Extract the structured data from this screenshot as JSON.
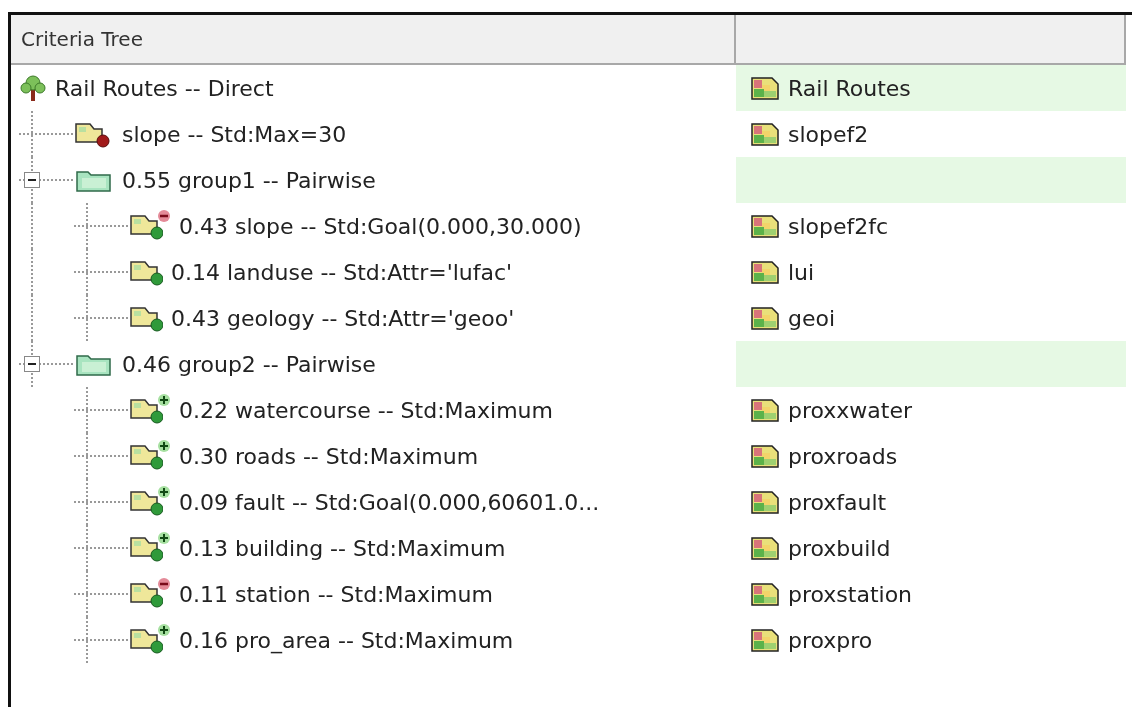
{
  "header": {
    "column_1": "Criteria Tree"
  },
  "tree": {
    "kind": "root",
    "label": "Rail Routes -- Direct",
    "layer": "Rail Routes",
    "children": [
      {
        "kind": "constraint",
        "label": "slope -- Std:Max=30",
        "layer": "slopef2"
      },
      {
        "kind": "group",
        "label": "0.55 group1 -- Pairwise",
        "expanded": true,
        "children": [
          {
            "kind": "minusfactor",
            "label": "0.43 slope -- Std:Goal(0.000,30.000)",
            "layer": "slopef2fc"
          },
          {
            "kind": "factor",
            "label": "0.14 landuse -- Std:Attr='lufac'",
            "layer": "lui"
          },
          {
            "kind": "factor",
            "label": "0.43 geology -- Std:Attr='geoo'",
            "layer": "geoi"
          }
        ]
      },
      {
        "kind": "group",
        "label": "0.46 group2 -- Pairwise",
        "expanded": true,
        "children": [
          {
            "kind": "plusfactor",
            "label": "0.22 watercourse -- Std:Maximum",
            "layer": "proxxwater"
          },
          {
            "kind": "plusfactor",
            "label": "0.30 roads -- Std:Maximum",
            "layer": "proxroads"
          },
          {
            "kind": "plusfactor",
            "label": "0.09 fault -- Std:Goal(0.000,60601.0...",
            "layer": "proxfault"
          },
          {
            "kind": "plusfactor",
            "label": "0.13 building -- Std:Maximum",
            "layer": "proxbuild"
          },
          {
            "kind": "minusfactor",
            "label": "0.11 station -- Std:Maximum",
            "layer": "proxstation"
          },
          {
            "kind": "plusfactor",
            "label": "0.16 pro_area -- Std:Maximum",
            "layer": "proxpro"
          }
        ]
      }
    ]
  }
}
